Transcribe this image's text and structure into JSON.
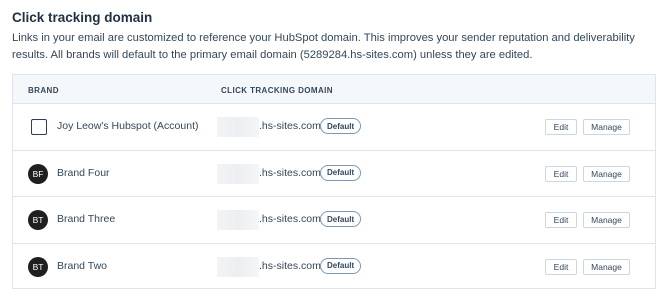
{
  "section": {
    "title": "Click tracking domain",
    "description": "Links in your email are customized to reference your HubSpot domain. This improves your sender reputation and deliverability results. All brands will default to the primary email domain (5289284.hs-sites.com) unless they are edited."
  },
  "table": {
    "headers": {
      "brand": "BRAND",
      "domain": "CLICK TRACKING DOMAIN"
    },
    "rows": [
      {
        "avatar": "",
        "icon": "checkbox-square-icon",
        "brand": "Joy Leow's Hubspot (Account)",
        "domain_suffix": ".hs-sites.com",
        "badge": "Default",
        "edit": "Edit",
        "manage": "Manage"
      },
      {
        "avatar": "BF",
        "brand": "Brand Four",
        "domain_suffix": ".hs-sites.com",
        "badge": "Default",
        "edit": "Edit",
        "manage": "Manage"
      },
      {
        "avatar": "BT",
        "brand": "Brand Three",
        "domain_suffix": ".hs-sites.com",
        "badge": "Default",
        "edit": "Edit",
        "manage": "Manage"
      },
      {
        "avatar": "BT",
        "brand": "Brand Two",
        "domain_suffix": ".hs-sites.com",
        "badge": "Default",
        "edit": "Edit",
        "manage": "Manage"
      }
    ]
  },
  "colors": {
    "avatar_bg": "#1f1f1f",
    "header_bg": "#f5f8fa",
    "border": "#dfe3eb",
    "text": "#33475b"
  }
}
